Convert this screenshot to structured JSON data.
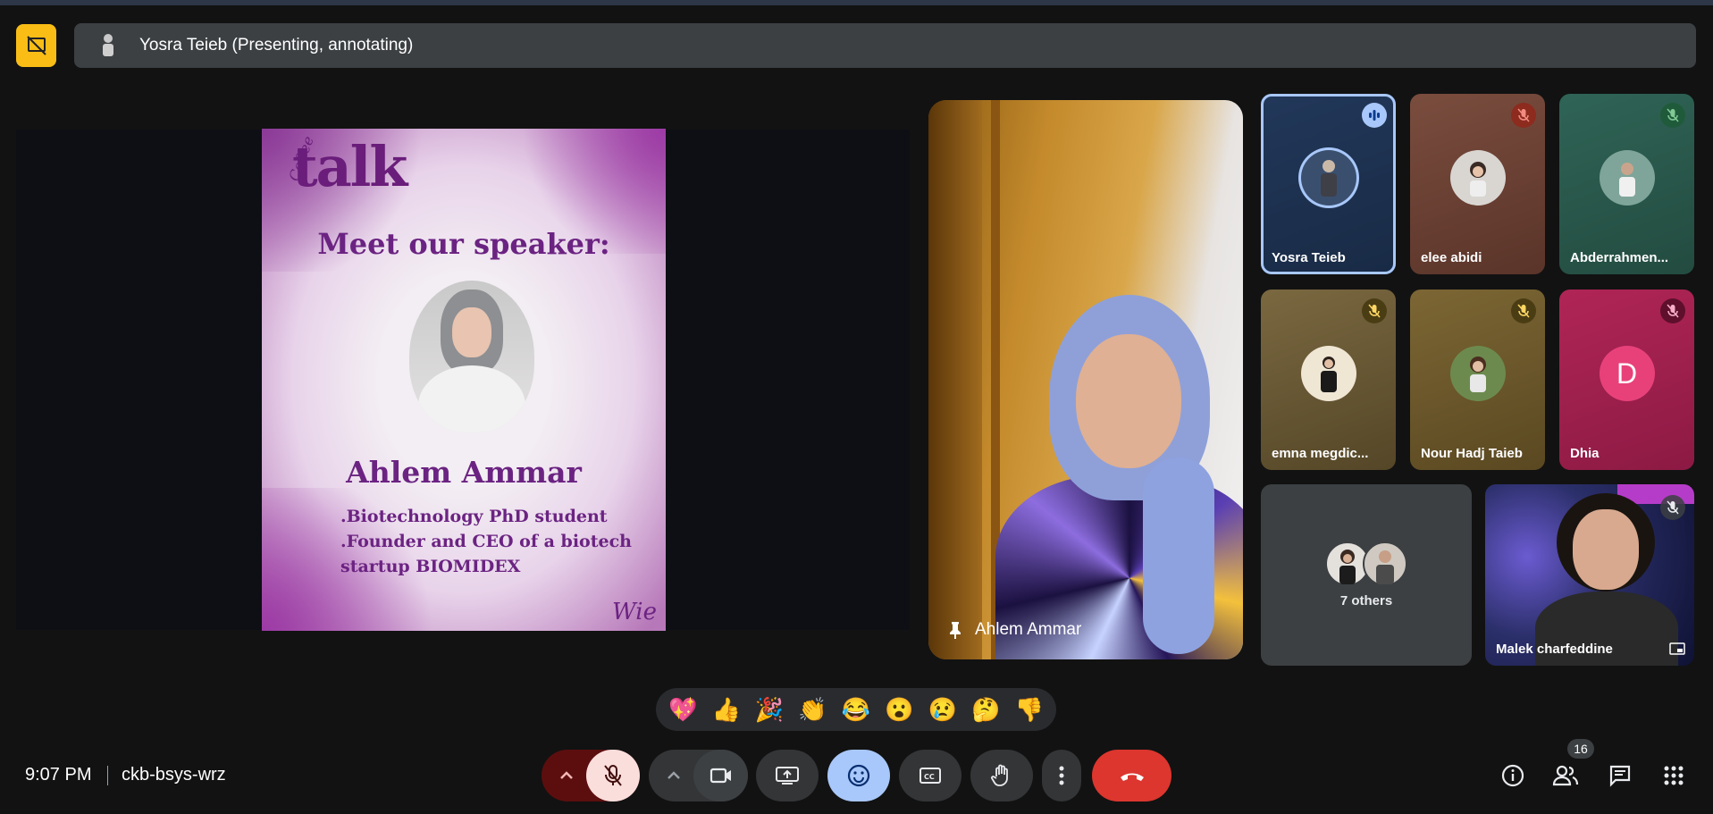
{
  "presenter_bar": {
    "text": "Yosra Teieb (Presenting, annotating)"
  },
  "presentation": {
    "logo": "talk",
    "logo_small": "Coffee",
    "heading": "Meet our speaker:",
    "speaker_name": "Ahlem Ammar",
    "lines": [
      ".Biotechnology PhD student",
      ".Founder and CEO of a biotech",
      "startup BIOMIDEX"
    ],
    "corner_logo": "Wie"
  },
  "main_video": {
    "name": "Ahlem Ammar",
    "pin_icon": "pin-icon"
  },
  "tiles": [
    {
      "name": "Yosra Teieb",
      "status_icon": "speaking-icon",
      "bg": "#1f3556"
    },
    {
      "name": "elee abidi",
      "status_icon": "mic-off-icon",
      "bg": "#6e4538"
    },
    {
      "name": "Abderrahmen...",
      "status_icon": "mic-off-icon",
      "bg": "#2b5a4c"
    },
    {
      "name": "emna megdic...",
      "status_icon": "mic-off-icon",
      "bg": "#6b5a38"
    },
    {
      "name": "Nour Hadj Taieb",
      "status_icon": "mic-off-icon",
      "bg": "#6f5a2c"
    },
    {
      "name": "Dhia",
      "status_icon": "mic-off-icon",
      "bg": "#a3214f",
      "initial": "D"
    },
    {
      "name": "7 others",
      "bg": "#3c4043"
    },
    {
      "name": "Malek charfeddine",
      "status_icon": "mic-off-icon",
      "bg": "#2b2f6a"
    }
  ],
  "reactions": [
    "💖",
    "👍",
    "🎉",
    "👏",
    "😂",
    "😮",
    "😢",
    "🤔",
    "👎"
  ],
  "footer": {
    "time": "9:07 PM",
    "meeting_code": "ckb-bsys-wrz",
    "people_count": "16"
  },
  "colors": {
    "accent": "#a8c7fa",
    "end_call": "#dc362e",
    "stop_share": "#f9bd16"
  }
}
